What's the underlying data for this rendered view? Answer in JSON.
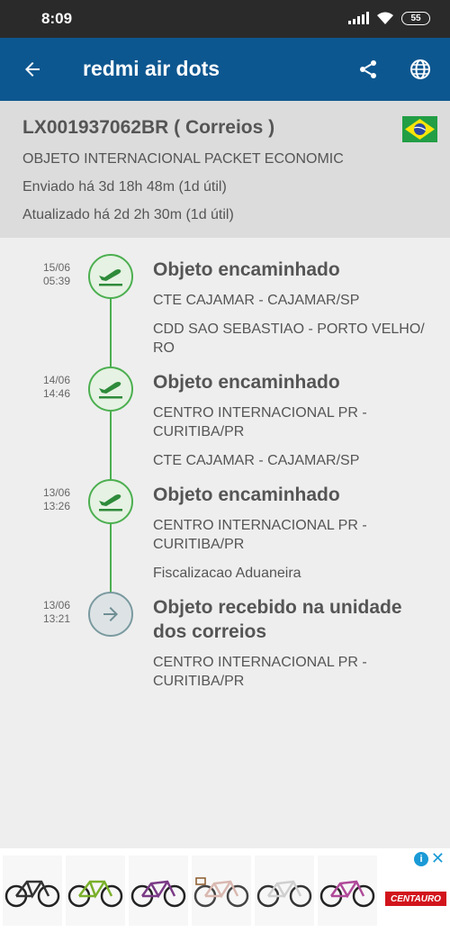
{
  "status_bar": {
    "time": "8:09",
    "battery": "55"
  },
  "app_bar": {
    "title": "redmi air dots"
  },
  "header": {
    "tracking_code": "LX001937062BR ( Correios )",
    "type": "OBJETO INTERNACIONAL PACKET ECONOMIC",
    "sent": "Enviado há 3d 18h 48m (1d útil)",
    "updated": "Atualizado há 2d 2h 30m (1d útil)"
  },
  "events": [
    {
      "date": "15/06",
      "time": "05:39",
      "icon": "plane-departure-icon",
      "title": "Objeto encaminhado",
      "from": "CTE CAJAMAR - CAJAMAR/SP",
      "to": "CDD SAO SEBASTIAO - PORTO VELHO/ RO"
    },
    {
      "date": "14/06",
      "time": "14:46",
      "icon": "plane-departure-icon",
      "title": "Objeto encaminhado",
      "from": "CENTRO INTERNACIONAL PR - CURITIBA/PR",
      "to": "CTE CAJAMAR - CAJAMAR/SP"
    },
    {
      "date": "13/06",
      "time": "13:26",
      "icon": "plane-departure-icon",
      "title": "Objeto encaminhado",
      "from": "CENTRO INTERNACIONAL PR - CURITIBA/PR",
      "to": "Fiscalizacao Aduaneira"
    },
    {
      "date": "13/06",
      "time": "13:21",
      "icon": "arrow-right-icon",
      "title": "Objeto recebido na unidade dos correios",
      "from": "CENTRO INTERNACIONAL PR - CURITIBA/PR"
    }
  ],
  "ad": {
    "brand": "CENTAURO",
    "info_icon": "info-icon",
    "close_icon": "close-icon"
  },
  "colors": {
    "app_bar": "#0d5790",
    "timeline_green": "#4caf50",
    "status_bar": "#2a2a2a"
  }
}
